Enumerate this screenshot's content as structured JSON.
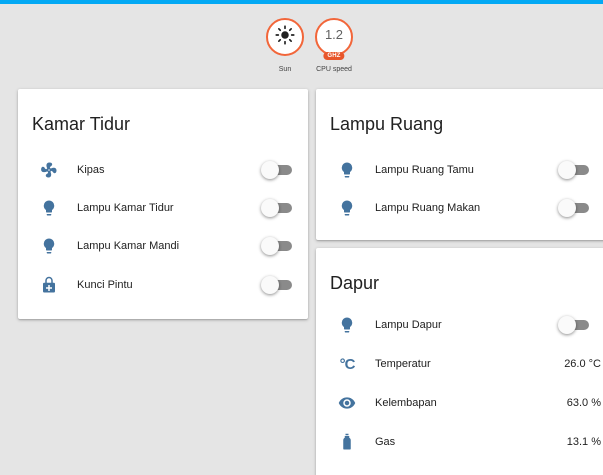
{
  "colors": {
    "accent": "#03a9f4",
    "icon": "#44739e",
    "badge_border": "#f2663a",
    "badge_unit_bg": "#e8552a"
  },
  "badges": [
    {
      "label": "Sun",
      "icon": "sun-icon"
    },
    {
      "label": "CPU speed",
      "value": "1.2",
      "unit": "GHZ"
    }
  ],
  "kamar_tidur": {
    "title": "Kamar Tidur",
    "items": [
      {
        "label": "Kipas",
        "icon": "fan-icon",
        "state": "off"
      },
      {
        "label": "Lampu Kamar Tidur",
        "icon": "lightbulb-icon",
        "state": "off"
      },
      {
        "label": "Lampu Kamar Mandi",
        "icon": "lightbulb-icon",
        "state": "off"
      },
      {
        "label": "Kunci Pintu",
        "icon": "lock-plus-icon",
        "state": "off"
      }
    ]
  },
  "lampu_ruang": {
    "title": "Lampu Ruang",
    "items": [
      {
        "label": "Lampu Ruang Tamu",
        "icon": "lightbulb-icon",
        "state": "off"
      },
      {
        "label": "Lampu Ruang Makan",
        "icon": "lightbulb-icon",
        "state": "off"
      }
    ]
  },
  "dapur": {
    "title": "Dapur",
    "items": [
      {
        "label": "Lampu Dapur",
        "icon": "lightbulb-icon",
        "state": "off"
      },
      {
        "label": "Temperatur",
        "icon": "thermometer-celsius-icon",
        "value": "26.0 °C"
      },
      {
        "label": "Kelembapan",
        "icon": "eye-icon",
        "value": "63.0 %"
      },
      {
        "label": "Gas",
        "icon": "gas-cylinder-icon",
        "value": "13.1 %"
      }
    ]
  }
}
